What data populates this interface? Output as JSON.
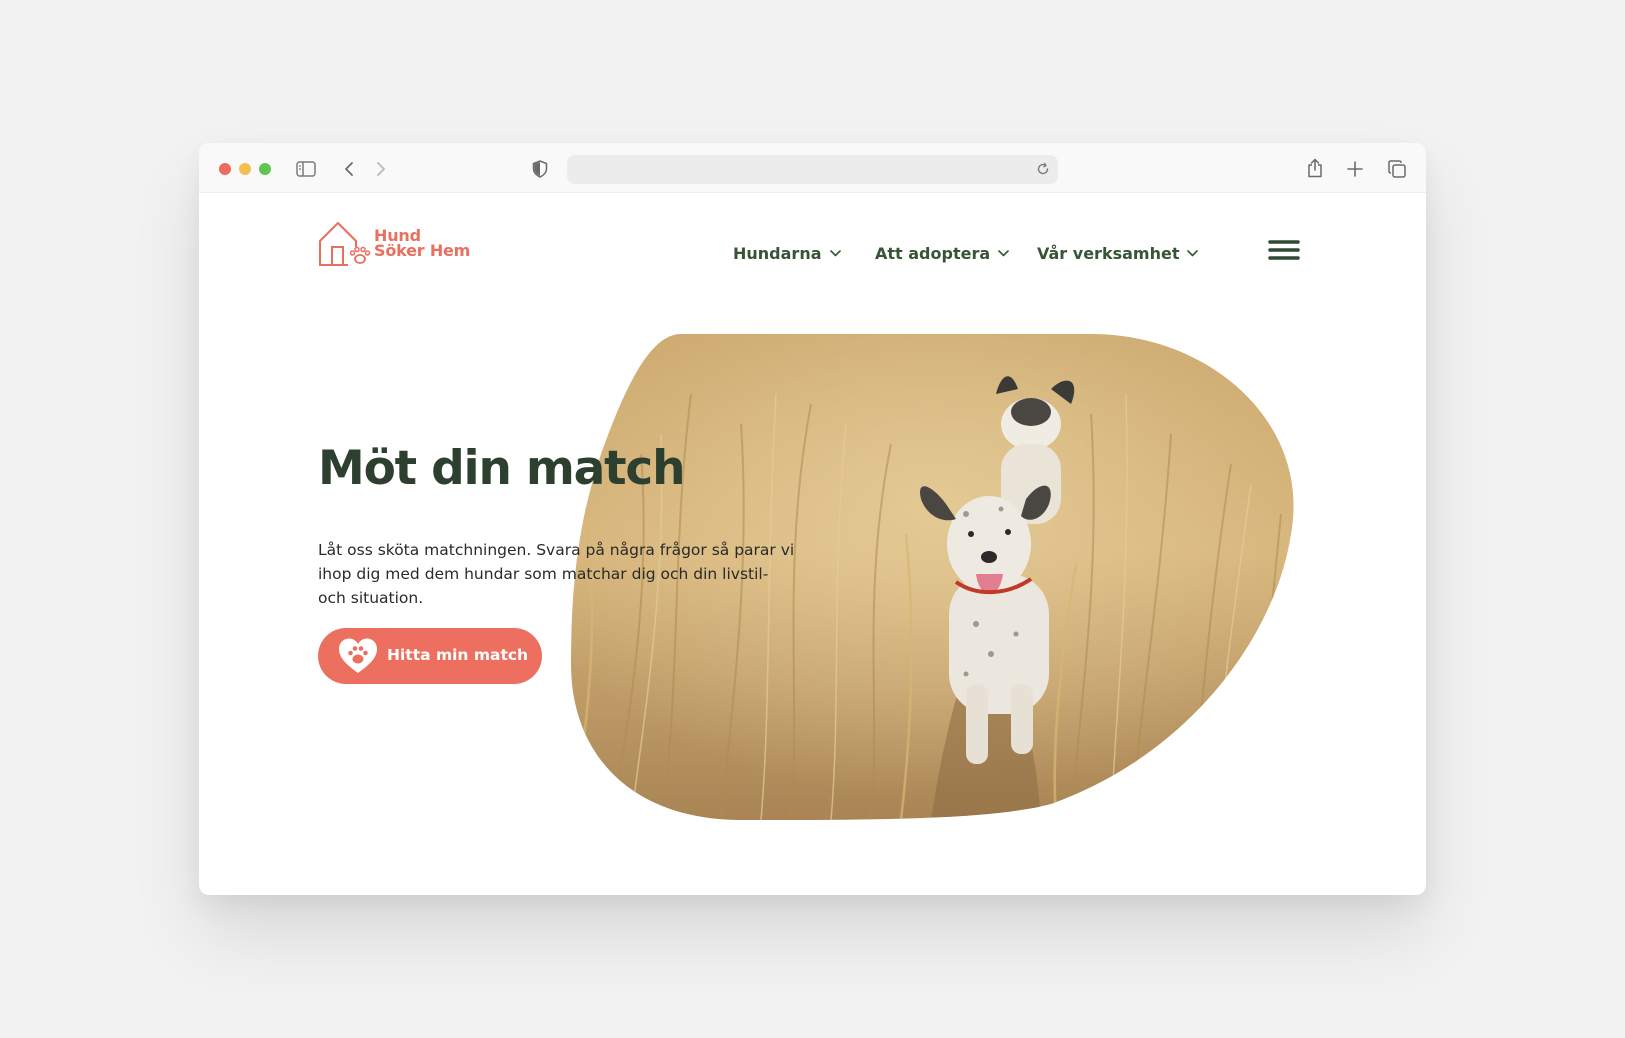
{
  "browser": {
    "icons": [
      "sidebar-icon",
      "back-icon",
      "forward-icon",
      "shield-icon",
      "reload-icon",
      "share-icon",
      "new-tab-icon",
      "tabs-icon"
    ],
    "address_value": ""
  },
  "logo": {
    "line1": "Hund",
    "line2": "Söker Hem",
    "color": "#e8705f"
  },
  "nav": {
    "items": [
      {
        "label": "Hundarna"
      },
      {
        "label": "Att adoptera"
      },
      {
        "label": "Vår verksamhet"
      }
    ],
    "color": "#375437"
  },
  "hero": {
    "title": "Möt din match",
    "text": "Låt oss sköta matchningen. Svara på några frågor så parar vi ihop dig med dem hundar som matchar dig och din livstil- och situation.",
    "cta_label": "Hitta min match",
    "cta_color": "#ec6f60",
    "image_subject": "two dogs running through a wheat field"
  }
}
